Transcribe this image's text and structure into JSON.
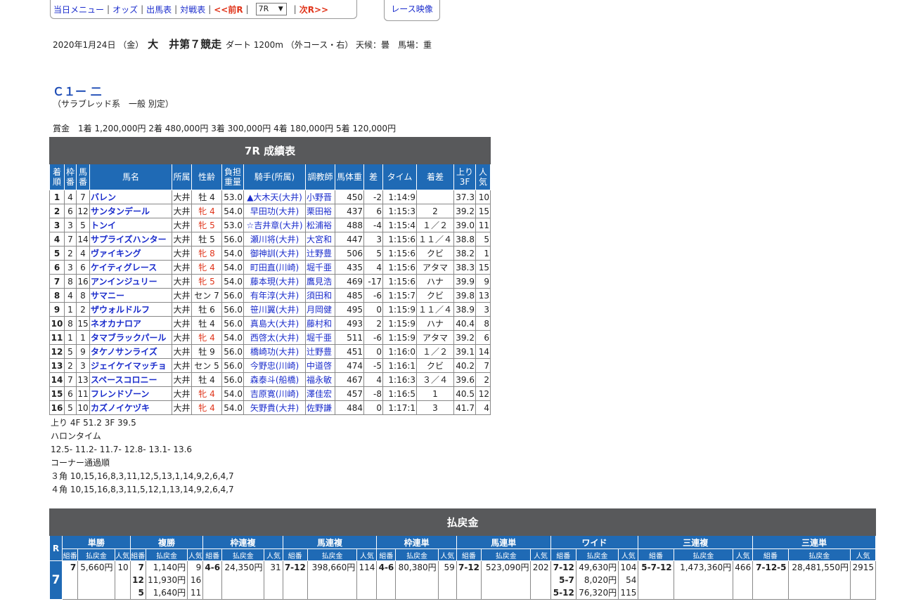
{
  "nav": {
    "items": [
      "当日メニュー",
      "オッズ",
      "出馬表",
      "対戦表"
    ],
    "prev": "<<前R",
    "race_select": "7R",
    "next": "次R>>",
    "video": "レース映像"
  },
  "race": {
    "date": "2020年1月24日 （金）",
    "venue": "大　井第７競走",
    "course": "ダート 1200m （外コース・右） 天候：曇　馬場：重",
    "class": "Ｃ１ー 二",
    "sub": "（サラブレッド系　一般 別定）",
    "prize": "賞金　1着 1,200,000円 2着 480,000円 3着 300,000円 4着 180,000円 5着 120,000円"
  },
  "results": {
    "title": "7R 成績表",
    "headers": [
      "着順",
      "枠番",
      "馬番",
      "馬名",
      "所属",
      "性齢",
      "負担重量",
      "騎手(所属)",
      "調教師",
      "馬体重",
      "差",
      "タイム",
      "着差",
      "上り3F",
      "人気"
    ],
    "rows": [
      [
        "1",
        "4",
        "7",
        "バレン",
        "大井",
        "牡 4",
        "53.0",
        "▲大木天(大井)",
        "小野晋",
        "450",
        "-2",
        "1:14:9",
        "",
        "37.3",
        "10"
      ],
      [
        "2",
        "6",
        "12",
        "サンタンデール",
        "大井",
        "牝 4",
        "54.0",
        "早田功(大井)",
        "栗田裕",
        "437",
        "6",
        "1:15:3",
        "2",
        "39.2",
        "15"
      ],
      [
        "3",
        "3",
        "5",
        "トンイ",
        "大井",
        "牝 5",
        "53.0",
        "☆吉井章(大井)",
        "松浦裕",
        "488",
        "-4",
        "1:15:4",
        "１／２",
        "39.0",
        "11"
      ],
      [
        "4",
        "7",
        "14",
        "サプライズハンター",
        "大井",
        "牡 5",
        "56.0",
        "瀬川将(大井)",
        "大宮和",
        "447",
        "3",
        "1:15:6",
        "１１／４",
        "38.8",
        "5"
      ],
      [
        "5",
        "2",
        "4",
        "ヴァイキング",
        "大井",
        "牝 8",
        "54.0",
        "御神訓(大井)",
        "辻野豊",
        "506",
        "5",
        "1:15:6",
        "クビ",
        "38.2",
        "1"
      ],
      [
        "6",
        "3",
        "6",
        "ケイティグレース",
        "大井",
        "牝 4",
        "54.0",
        "町田直(川崎)",
        "堀千亜",
        "435",
        "4",
        "1:15:6",
        "アタマ",
        "38.3",
        "15"
      ],
      [
        "7",
        "8",
        "16",
        "アンインジュリー",
        "大井",
        "牝 5",
        "54.0",
        "藤本現(大井)",
        "鷹見浩",
        "469",
        "-17",
        "1:15:6",
        "ハナ",
        "39.9",
        "9"
      ],
      [
        "8",
        "4",
        "8",
        "サマニー",
        "大井",
        "セン 7",
        "56.0",
        "有年淳(大井)",
        "須田和",
        "485",
        "-6",
        "1:15:7",
        "クビ",
        "39.8",
        "13"
      ],
      [
        "9",
        "1",
        "2",
        "ザウォルドルフ",
        "大井",
        "牡 6",
        "56.0",
        "笹川翼(大井)",
        "月岡健",
        "495",
        "0",
        "1:15:9",
        "１１／４",
        "38.9",
        "3"
      ],
      [
        "10",
        "8",
        "15",
        "ネオカナロア",
        "大井",
        "牡 4",
        "56.0",
        "真島大(大井)",
        "藤村和",
        "493",
        "2",
        "1:15:9",
        "ハナ",
        "40.4",
        "8"
      ],
      [
        "11",
        "1",
        "1",
        "タマブラックパール",
        "大井",
        "牝 4",
        "54.0",
        "西啓太(大井)",
        "堀千亜",
        "511",
        "-6",
        "1:15:9",
        "アタマ",
        "39.2",
        "6"
      ],
      [
        "12",
        "5",
        "9",
        "タケノサンライズ",
        "大井",
        "牡 9",
        "56.0",
        "橋崎功(大井)",
        "辻野豊",
        "451",
        "0",
        "1:16:0",
        "１／２",
        "39.1",
        "14"
      ],
      [
        "13",
        "2",
        "3",
        "ジェイケイマッチョ",
        "大井",
        "セン 5",
        "56.0",
        "今野忠(川崎)",
        "中道啓",
        "474",
        "-5",
        "1:16:1",
        "クビ",
        "40.2",
        "7"
      ],
      [
        "14",
        "7",
        "13",
        "スペースコロニー",
        "大井",
        "牡 4",
        "56.0",
        "森泰斗(船橋)",
        "福永敏",
        "467",
        "4",
        "1:16:3",
        "３／４",
        "39.6",
        "2"
      ],
      [
        "15",
        "6",
        "11",
        "フレンドゾーン",
        "大井",
        "牝 4",
        "54.0",
        "吉原寛(川崎)",
        "澤佳宏",
        "457",
        "-8",
        "1:16:5",
        "1",
        "40.5",
        "12"
      ],
      [
        "16",
        "5",
        "10",
        "カズノイケヅキ",
        "大井",
        "牝 4",
        "54.0",
        "矢野貴(大井)",
        "佐野謙",
        "484",
        "0",
        "1:17:1",
        "3",
        "41.7",
        "4"
      ]
    ]
  },
  "below": {
    "agari": "上り 4F 51.2 3F 39.5",
    "furlong_label": "ハロンタイム",
    "furlong": "12.5- 11.2- 11.7- 12.8- 13.1- 13.6",
    "corner_label": "コーナー通過順",
    "corner3": "３角 10,15,16,8,3,11,12,5,13,1,14,9,2,6,4,7",
    "corner4": "４角 10,15,16,8,3,11,5,12,1,13,14,9,2,6,4,7"
  },
  "payout": {
    "title": "払戻金",
    "r_label": "R",
    "race_no": "7",
    "sub_headers": [
      "組番",
      "払戻金",
      "人気"
    ],
    "types": [
      "単勝",
      "複勝",
      "枠連複",
      "馬連複",
      "枠連単",
      "馬連単",
      "ワイド",
      "三連複",
      "三連単"
    ],
    "tansho": {
      "kumi": "7",
      "amount": "5,660円",
      "ninki": "10"
    },
    "fukusho": [
      {
        "kumi": "7",
        "amount": "1,140円",
        "ninki": "9"
      },
      {
        "kumi": "12",
        "amount": "11,930円",
        "ninki": "16"
      },
      {
        "kumi": "5",
        "amount": "1,640円",
        "ninki": "11"
      }
    ],
    "wakuren_fuku": {
      "kumi": "4-6",
      "amount": "24,350円",
      "ninki": "31"
    },
    "umaren_fuku": {
      "kumi": "7-12",
      "amount": "398,660円",
      "ninki": "114"
    },
    "wakuren_tan": {
      "kumi": "4-6",
      "amount": "80,380円",
      "ninki": "59"
    },
    "umaren_tan": {
      "kumi": "7-12",
      "amount": "523,090円",
      "ninki": "202"
    },
    "wide": [
      {
        "kumi": "7-12",
        "amount": "49,630円",
        "ninki": "104"
      },
      {
        "kumi": "5-7",
        "amount": "8,020円",
        "ninki": "54"
      },
      {
        "kumi": "5-12",
        "amount": "76,320円",
        "ninki": "115"
      }
    ],
    "sanrenpuku": {
      "kumi": "5-7-12",
      "amount": "1,473,360円",
      "ninki": "466"
    },
    "sanrentan": {
      "kumi": "7-12-5",
      "amount": "28,481,550円",
      "ninki": "2915"
    }
  },
  "colors": {
    "header_blue": "#1f6ab5",
    "title_gray": "#58595b",
    "link_blue": "#1a2ccc",
    "mare_red": "#e0341a"
  }
}
